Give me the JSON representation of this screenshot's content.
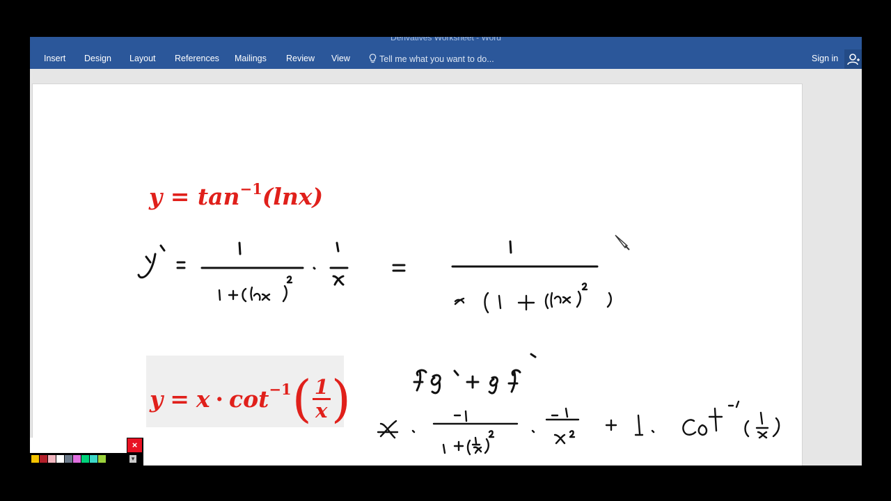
{
  "window": {
    "title": "Derivatives Worksheet - Word",
    "accent_color": "#2b579a"
  },
  "ribbon": {
    "tabs": [
      {
        "label": "Insert"
      },
      {
        "label": "Design"
      },
      {
        "label": "Layout"
      },
      {
        "label": "References"
      },
      {
        "label": "Mailings"
      },
      {
        "label": "Review"
      },
      {
        "label": "View"
      }
    ],
    "tell_me_placeholder": "Tell me what you want to do...",
    "tell_me_icon": "lightbulb-icon",
    "sign_in_label": "Sign in",
    "share_icon": "person-icon"
  },
  "document": {
    "equation1": {
      "lhs": "y",
      "eq": "=",
      "fn": "tan",
      "exp": "−1",
      "arg": "(lnx)"
    },
    "equation2": {
      "lhs": "y",
      "eq": "=",
      "x": "x",
      "dot": "·",
      "fn": "cot",
      "exp": "−1",
      "lparen": "(",
      "num": "1",
      "den": "x",
      "rparen": ")"
    },
    "equation_color": "#e0201b",
    "ink_color": "#111111"
  },
  "pen_toolbar": {
    "close_label": "×",
    "menu_label": "▾",
    "swatches": [
      "#f5c400",
      "#b3202a",
      "#f2b6c0",
      "#ffffff",
      "#6b7a8a",
      "#e070e0",
      "#00d27a",
      "#3cd8c8",
      "#9bd23c"
    ]
  }
}
